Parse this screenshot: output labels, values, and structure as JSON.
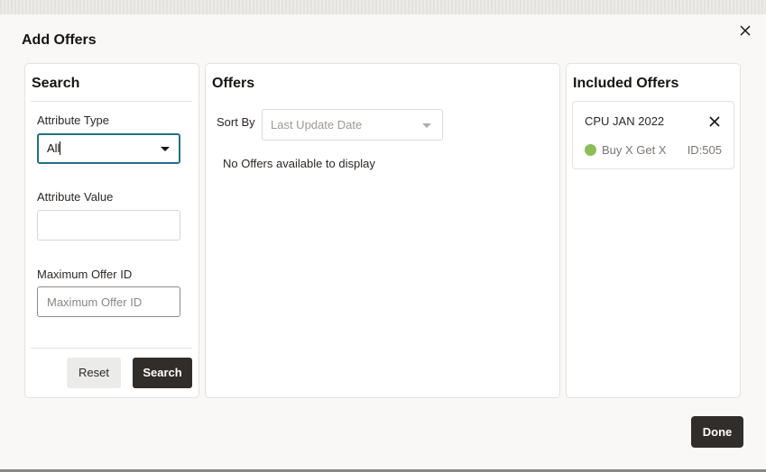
{
  "dialog": {
    "title": "Add Offers",
    "close_icon": "close-icon",
    "done_label": "Done"
  },
  "search_panel": {
    "title": "Search",
    "attribute_type": {
      "label": "Attribute Type",
      "value": "All",
      "icon": "caret-down-icon"
    },
    "attribute_value": {
      "label": "Attribute Value",
      "value": "",
      "placeholder": ""
    },
    "max_offer_id": {
      "label": "Maximum Offer ID",
      "value": "",
      "placeholder": "Maximum Offer ID"
    },
    "reset_label": "Reset",
    "search_label": "Search"
  },
  "offers_panel": {
    "title": "Offers",
    "sort_by_label": "Sort By",
    "sort_by_value": "Last Update Date",
    "empty_message": "No Offers available to display"
  },
  "included_panel": {
    "title": "Included Offers",
    "items": [
      {
        "name": "CPU JAN 2022",
        "type": "Buy X Get X",
        "id": "ID:505",
        "status_color": "#8cbd57"
      }
    ]
  },
  "colors": {
    "primary_button": "#312d2a",
    "focus_border": "#227088",
    "status_active": "#8cbd57"
  }
}
